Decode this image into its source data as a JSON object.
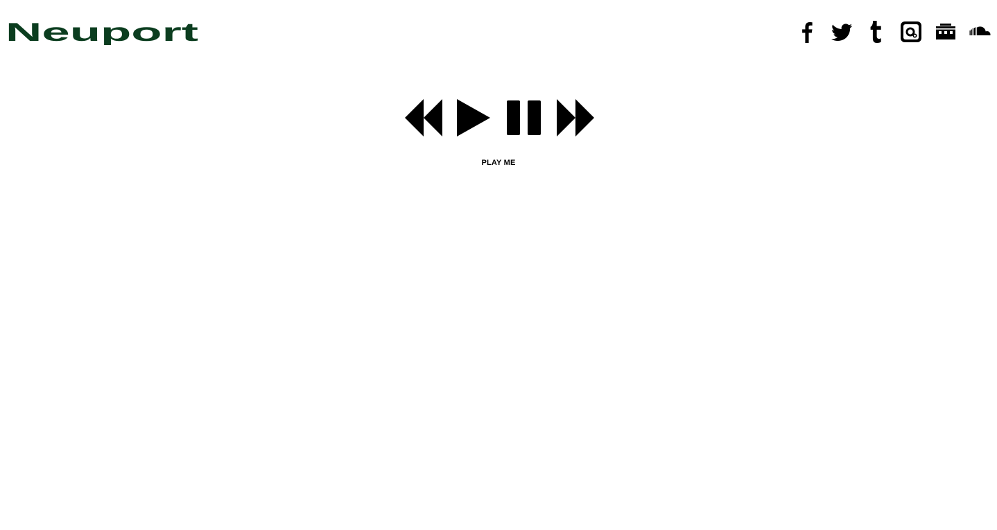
{
  "brand": {
    "name": "Neuport",
    "color": "#0b3d1f"
  },
  "social": [
    {
      "name": "facebook-icon"
    },
    {
      "name": "twitter-icon"
    },
    {
      "name": "tumblr-icon"
    },
    {
      "name": "instagram-icon"
    },
    {
      "name": "bandcamp-icon"
    },
    {
      "name": "soundcloud-icon"
    }
  ],
  "player": {
    "controls": [
      "rewind-icon",
      "play-icon",
      "pause-icon",
      "fast-forward-icon"
    ],
    "caption": "PLAY ME"
  },
  "colors": {
    "icon": "#000000",
    "background": "#ffffff"
  }
}
